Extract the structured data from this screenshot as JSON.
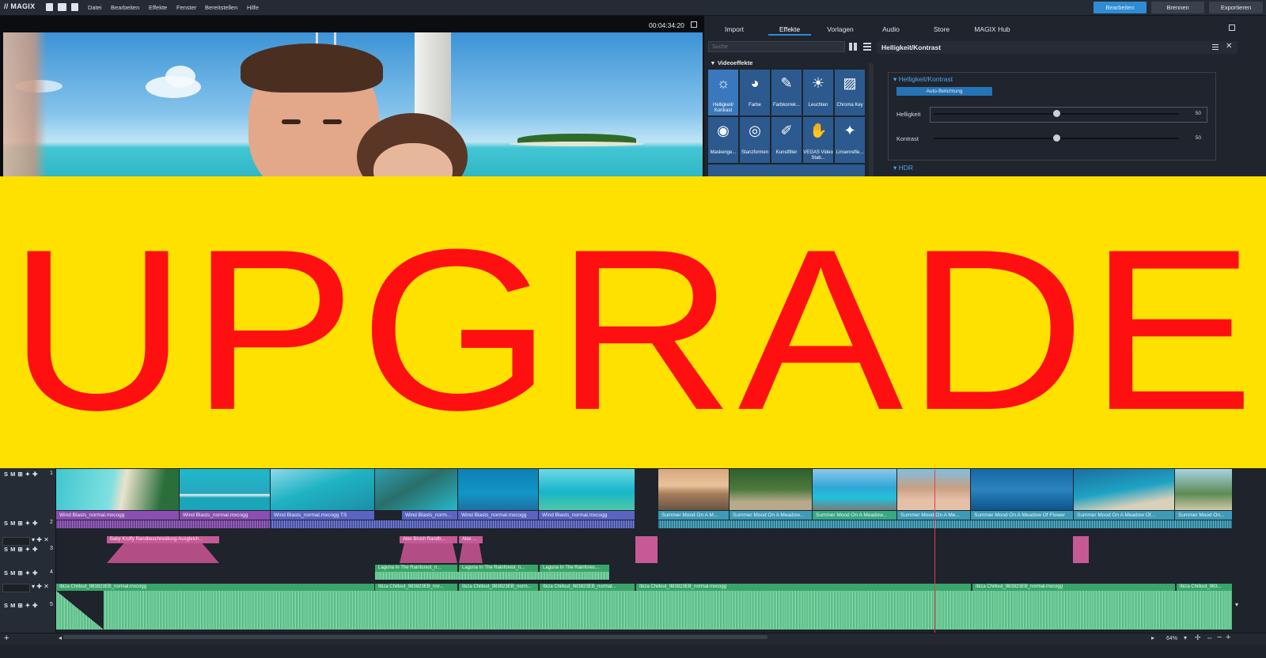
{
  "app": {
    "logo": "// MAGIX"
  },
  "menu": [
    "Datei",
    "Bearbeiten",
    "Effekte",
    "Fenster",
    "Bereitstellen",
    "Hilfe"
  ],
  "mode_buttons": {
    "edit": "Bearbeiten",
    "burn": "Brennen",
    "export": "Exportieren"
  },
  "preview": {
    "timecode": "00:04:34:20"
  },
  "panel": {
    "tabs": [
      "Import",
      "Effekte",
      "Vorlagen",
      "Audio",
      "Store",
      "MAGIX Hub"
    ],
    "active_tab": "Effekte",
    "search_placeholder": "Suche",
    "section": "Videoeffekte",
    "effects": [
      "Helligkeit/ Kontrast",
      "Farbe",
      "Farbkorrek...",
      "Leuchten",
      "Chroma Key",
      "Maskenge...",
      "Stanzformen",
      "Kunstfilter",
      "VEGAS Video Stab...",
      "Linsenrefle..."
    ],
    "detail": {
      "title": "Helligkeit/Kontrast",
      "group": "Helligkeit/Kontrast",
      "auto_button": "Auto-Belichtung",
      "sliders": [
        {
          "label": "Helligkeit",
          "value": "50",
          "level": 0.5
        },
        {
          "label": "Kontrast",
          "value": "50",
          "level": 0.5
        }
      ],
      "next_group": "HDR"
    }
  },
  "banner": {
    "text": "UPGRADE",
    "bg": "#ffe100",
    "color": "#ff1010"
  },
  "timeline": {
    "track_controls": "S M",
    "track_numbers": [
      "1",
      "2",
      "3",
      "4",
      "5"
    ],
    "track2_clips": [
      "Wind Blasts_normal.mxcogg",
      "Wind Blasts_normal.mxcogg",
      "Wind Blasts_normal.mxcogg  TS",
      "Wind Blasts_norm...",
      "Wind Blasts_normal.mxcogg",
      "Wind Blasts_normal.mxcogg",
      "Summer Mood On A M...",
      "Summer Mood On A Meadow...",
      "Summer Mood On A Meadow...",
      "Summer Mood On A Me...",
      "Summer Mood On A Meadow Of Flower",
      "Summer Mood On A Meadow Of...",
      "Summer Mood On..."
    ],
    "track3_clips": [
      "Baby Kruffy   Randbeschneidung-Ausgleich...",
      "Alex Brush   Randb...",
      "Alex ..."
    ],
    "track4_clips": [
      "Laguna In The Rainforest_n...",
      "Laguna In The Rainforest_n...",
      "Laguna In The Rainfores..."
    ],
    "track5_clips": [
      "Ibiza Chillout_983823EB_normal.mxcogg",
      "Ibiza Chillout_983823EB_nor...",
      "Ibiza Chillout_983823EB_norm...",
      "Ibiza Chillout_983823EB_normat...",
      "Ibiza Chillout_983823EB_normal.mxcogg",
      "Ibiza Chillout_983823EB_normal.mxcogg",
      "Ibiza Chillout_983..."
    ],
    "zoom": "64%"
  },
  "colors": {
    "accent": "#2f8bd4",
    "pink": "#b34d86",
    "green": "#3aa56a",
    "purple": "#7a59b8",
    "teal": "#3e9bb6"
  }
}
